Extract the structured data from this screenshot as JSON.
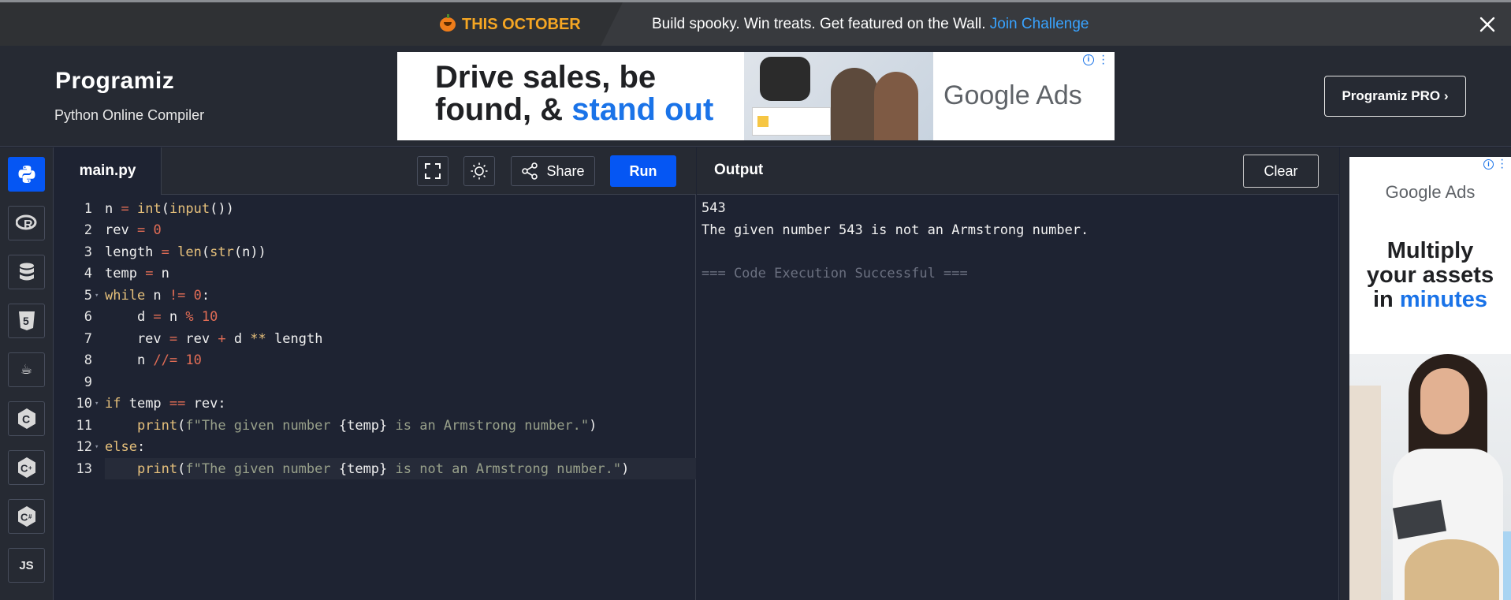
{
  "promo": {
    "tag": "THIS OCTOBER",
    "message": "Build spooky. Win treats. Get featured on the Wall.",
    "link": "Join Challenge"
  },
  "header": {
    "logo": "Programiz",
    "subtitle": "Python Online Compiler",
    "pro_button": "Programiz PRO ›"
  },
  "ad_top": {
    "headline_1": "Drive sales, be",
    "headline_2a": "found, & ",
    "headline_2b": "stand out",
    "brand": "Google Ads"
  },
  "sidebar": {
    "items": [
      {
        "icon": "python-icon",
        "active": true
      },
      {
        "icon": "r-icon",
        "glyph": "R"
      },
      {
        "icon": "sql-database-icon"
      },
      {
        "icon": "html5-icon",
        "glyph": "5"
      },
      {
        "icon": "java-icon",
        "glyph": "☕"
      },
      {
        "icon": "c-icon",
        "glyph": "C"
      },
      {
        "icon": "cpp-icon",
        "glyph": "C"
      },
      {
        "icon": "csharp-icon",
        "glyph": "C"
      },
      {
        "icon": "javascript-icon",
        "glyph": "JS"
      }
    ]
  },
  "editor": {
    "tab": "main.py",
    "share_label": "Share",
    "run_label": "Run",
    "active_line": 13,
    "lines": [
      "n = int(input())",
      "rev = 0",
      "length = len(str(n))",
      "temp = n",
      "while n != 0:",
      "    d = n % 10",
      "    rev = rev + d ** length",
      "    n //= 10",
      "",
      "if temp == rev:",
      "    print(f\"The given number {temp} is an Armstrong number.\")",
      "else:",
      "    print(f\"The given number {temp} is not an Armstrong number.\")"
    ]
  },
  "output": {
    "title": "Output",
    "clear_label": "Clear",
    "lines": [
      "543",
      "The given number 543 is not an Armstrong number.",
      "",
      "=== Code Execution Successful ==="
    ]
  },
  "ad_right": {
    "brand": "Google Ads",
    "headline_1": "Multiply",
    "headline_2": "your assets",
    "headline_3a": "in ",
    "headline_3b": "minutes"
  },
  "colors": {
    "accent": "#0556f3",
    "bg": "#1e2332",
    "panel": "#262a33",
    "promo_tag": "#f5a623",
    "link": "#38a3ff"
  }
}
